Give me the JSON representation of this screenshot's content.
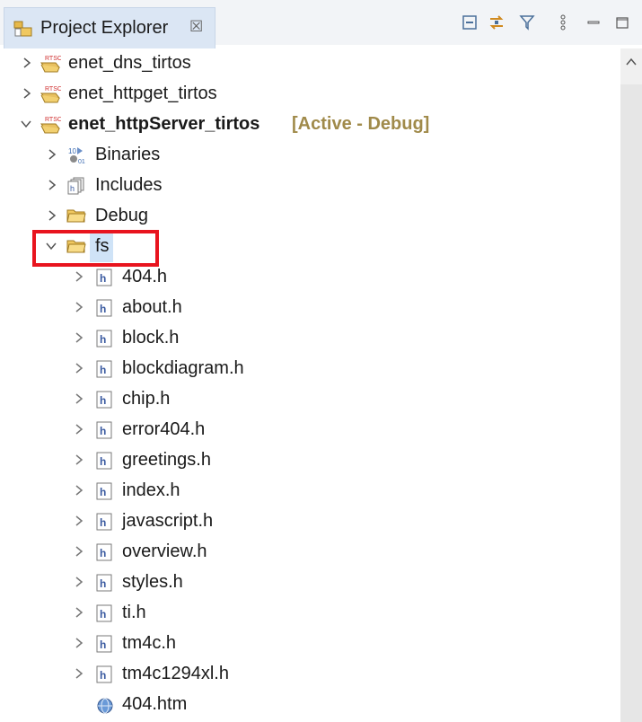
{
  "view": {
    "title": "Project Explorer",
    "close_glyph": "☒",
    "toolbar_icons": [
      "collapse-all-icon",
      "link-with-editor-icon",
      "filter-icon",
      "view-menu-icon",
      "minimize-icon",
      "maximize-icon"
    ]
  },
  "tree": [
    {
      "label": "enet_dns_tirtos",
      "expanded": false,
      "icon": "project-icon"
    },
    {
      "label": "enet_httpget_tirtos",
      "expanded": false,
      "icon": "project-icon"
    },
    {
      "label": "enet_httpServer_tirtos",
      "status": "[Active - Debug]",
      "expanded": true,
      "icon": "project-icon"
    },
    {
      "label": "Binaries",
      "expanded": false,
      "icon": "binaries-icon"
    },
    {
      "label": "Includes",
      "expanded": false,
      "icon": "includes-icon"
    },
    {
      "label": "Debug",
      "expanded": false,
      "icon": "folder-icon"
    },
    {
      "label": "fs",
      "expanded": true,
      "selected": true,
      "icon": "folder-open-icon"
    },
    {
      "label": "404.h",
      "icon": "header-file-icon"
    },
    {
      "label": "about.h",
      "icon": "header-file-icon"
    },
    {
      "label": "block.h",
      "icon": "header-file-icon"
    },
    {
      "label": "blockdiagram.h",
      "icon": "header-file-icon"
    },
    {
      "label": "chip.h",
      "icon": "header-file-icon"
    },
    {
      "label": "error404.h",
      "icon": "header-file-icon"
    },
    {
      "label": "greetings.h",
      "icon": "header-file-icon"
    },
    {
      "label": "index.h",
      "icon": "header-file-icon"
    },
    {
      "label": "javascript.h",
      "icon": "header-file-icon"
    },
    {
      "label": "overview.h",
      "icon": "header-file-icon"
    },
    {
      "label": "styles.h",
      "icon": "header-file-icon"
    },
    {
      "label": "ti.h",
      "icon": "header-file-icon"
    },
    {
      "label": "tm4c.h",
      "icon": "header-file-icon"
    },
    {
      "label": "tm4c1294xl.h",
      "icon": "header-file-icon"
    },
    {
      "label": "404.htm",
      "icon": "web-file-icon"
    }
  ]
}
